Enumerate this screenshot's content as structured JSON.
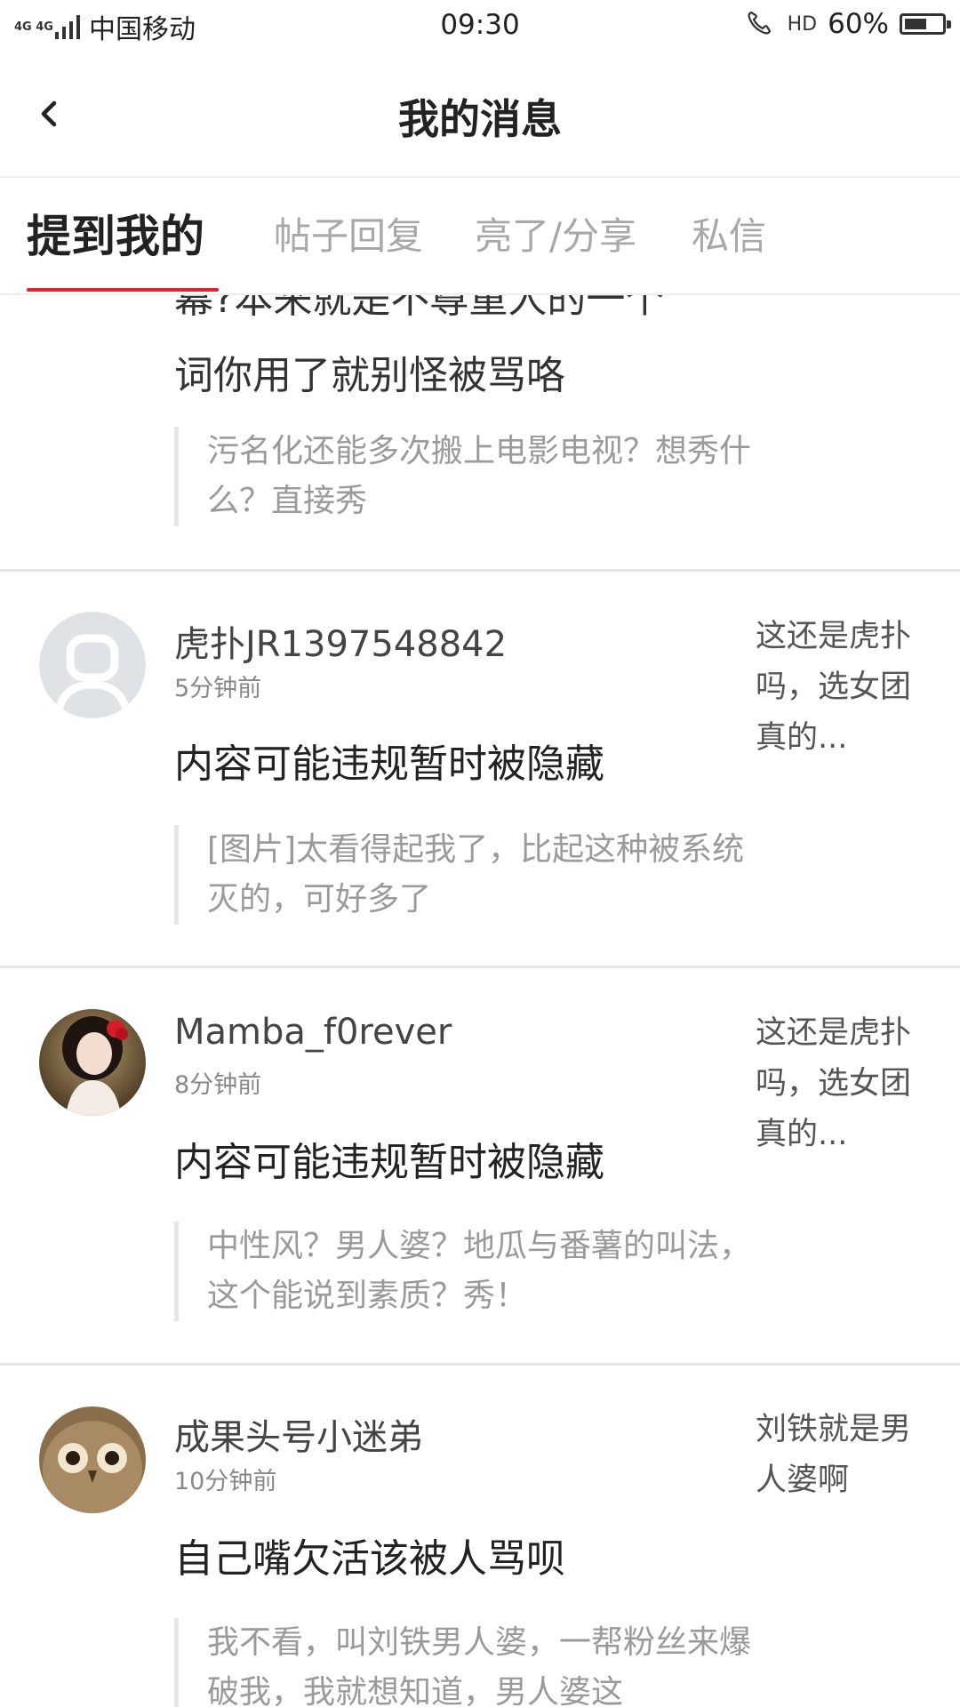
{
  "status_bar": {
    "network": "4G 4G",
    "carrier": "中国移动",
    "time": "09:30",
    "call_icon": "HD",
    "battery_pct_label": "60%",
    "battery_level": 0.6
  },
  "header": {
    "title": "我的消息",
    "back_icon": "chevron-left-icon"
  },
  "tabs": [
    {
      "label": "提到我的",
      "active": true
    },
    {
      "label": "帖子回复",
      "active": false
    },
    {
      "label": "亮了/分享",
      "active": false
    },
    {
      "label": "私信",
      "active": false
    }
  ],
  "accent_color": "#d8282d",
  "partial_item": {
    "content_line1": "幕?本来就是不尊重人的一个",
    "content_line2": "词你用了就别怪被骂咯",
    "quote": "污名化还能多次搬上电影电视？想秀什么？直接秀"
  },
  "messages": [
    {
      "username": "虎扑JR1397548842",
      "time": "5分钟前",
      "content": "内容可能违规暂时被隐藏",
      "quote": "[图片]太看得起我了，比起这种被系统灭的，可好多了",
      "reference": "这还是虎扑吗，选女团真的...",
      "avatar": "default-avatar"
    },
    {
      "username": "Mamba_f0rever",
      "time": "8分钟前",
      "content": "内容可能违规暂时被隐藏",
      "quote": "中性风？男人婆？地瓜与番薯的叫法，这个能说到素质？秀！",
      "reference": "这还是虎扑吗，选女团真的...",
      "avatar": "user-photo-avatar"
    },
    {
      "username": "成果头号小迷弟",
      "time": "10分钟前",
      "content": "自己嘴欠活该被人骂呗",
      "quote": "我不看，叫刘铁男人婆，一帮粉丝来爆破我，我就想知道，男人婆这",
      "reference": "刘铁就是男人婆啊",
      "avatar": "owl-avatar"
    }
  ]
}
